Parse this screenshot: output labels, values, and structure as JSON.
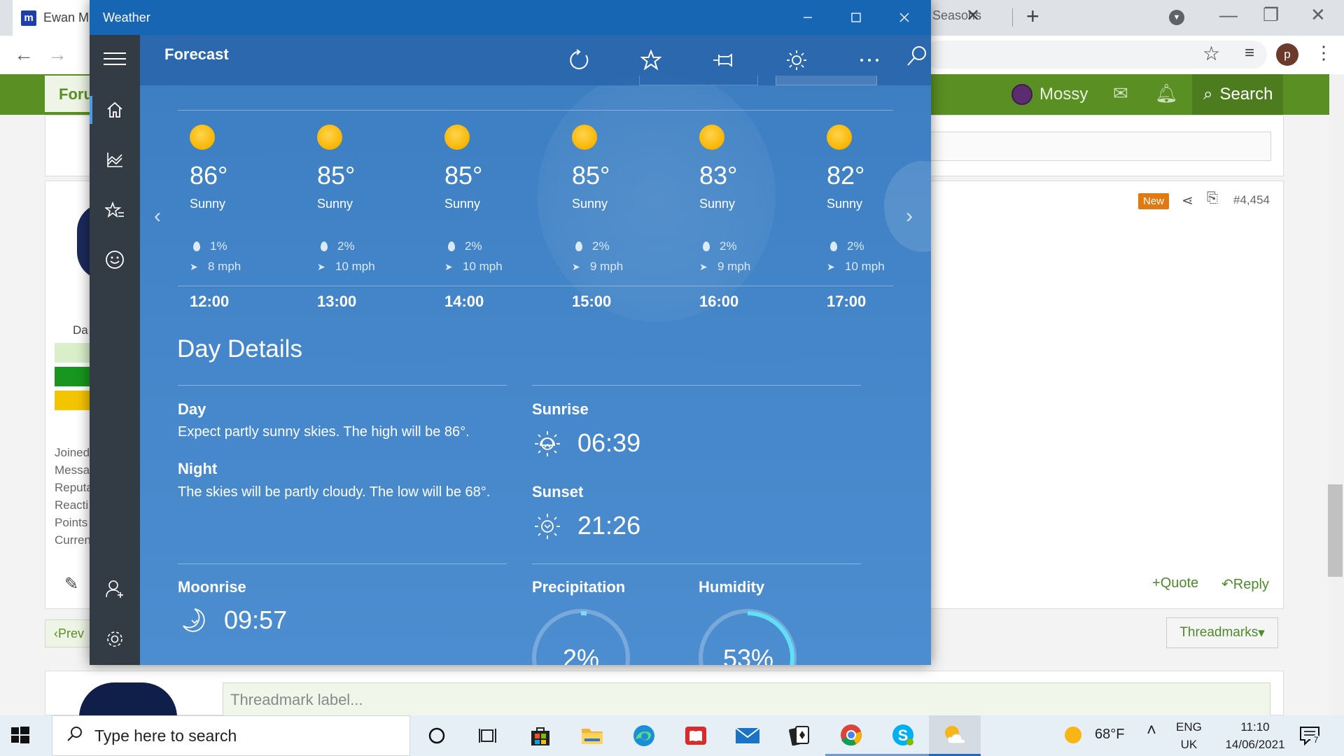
{
  "browser": {
    "tab_active_title": "Ewan M",
    "tab_active_icon": "m",
    "tab2_title": "Seasons",
    "tab2_close": "✕",
    "new_tab": "+",
    "profile_initial": "p"
  },
  "forum": {
    "nav_tab": "Foru",
    "user_name": "Mossy",
    "search_label": "Search",
    "post_badge": "New",
    "post_number": "#4,454",
    "quote_label": "Quote",
    "reply_label": "Reply",
    "threadmarks_label": "Threadmarks",
    "prev_label": "Prev",
    "threadmark_placeholder": "Threadmark label...",
    "user_da": "Da",
    "side_stats": [
      "Joined",
      "Messa",
      "Reputa",
      "Reacti",
      "Points",
      "Curren"
    ]
  },
  "weather": {
    "window_title": "Weather",
    "page_title": "Forecast",
    "colors": {
      "titlebar": "#1766b3",
      "sidebar": "#333b44",
      "accent": "#4a9be8",
      "sun": "#f7b500"
    },
    "sidebar_icons": [
      "menu-icon",
      "home-icon",
      "chart-icon",
      "favorites-icon",
      "smiley-icon",
      "add-user-icon",
      "settings-icon"
    ],
    "header_icons": [
      "refresh-icon",
      "star-icon",
      "pin-icon",
      "brightness-icon",
      "more-icon",
      "search-icon"
    ],
    "hourly": [
      {
        "temp": "86°",
        "cond": "Sunny",
        "precip": "1%",
        "wind": "8 mph",
        "time": "12:00"
      },
      {
        "temp": "85°",
        "cond": "Sunny",
        "precip": "2%",
        "wind": "10 mph",
        "time": "13:00"
      },
      {
        "temp": "85°",
        "cond": "Sunny",
        "precip": "2%",
        "wind": "10 mph",
        "time": "14:00"
      },
      {
        "temp": "85°",
        "cond": "Sunny",
        "precip": "2%",
        "wind": "9 mph",
        "time": "15:00"
      },
      {
        "temp": "83°",
        "cond": "Sunny",
        "precip": "2%",
        "wind": "9 mph",
        "time": "16:00"
      },
      {
        "temp": "82°",
        "cond": "Sunny",
        "precip": "2%",
        "wind": "10 mph",
        "time": "17:00"
      }
    ],
    "day_details": {
      "heading": "Day Details",
      "day_label": "Day",
      "day_text": "Expect partly sunny skies. The high will be 86°.",
      "night_label": "Night",
      "night_text": "The skies will be partly cloudy. The low will be 68°.",
      "sunrise_label": "Sunrise",
      "sunrise_time": "06:39",
      "sunset_label": "Sunset",
      "sunset_time": "21:26",
      "moonrise_label": "Moonrise",
      "moonrise_time": "09:57",
      "precipitation_label": "Precipitation",
      "precipitation_value": "2%",
      "precipitation_fraction": 0.02,
      "humidity_label": "Humidity",
      "humidity_value": "53%",
      "humidity_fraction": 0.53
    }
  },
  "taskbar": {
    "search_placeholder": "Type here to search",
    "weather_temp": "68°F",
    "lang_line1": "ENG",
    "lang_line2": "UK",
    "time": "11:10",
    "date": "14/06/2021",
    "notification_count": "7",
    "apps": [
      "cortana-icon",
      "task-view-icon",
      "store-icon",
      "file-explorer-icon",
      "edge-icon",
      "reader-icon",
      "mail-icon",
      "solitaire-icon",
      "chrome-icon",
      "skype-icon",
      "weather-icon"
    ]
  }
}
